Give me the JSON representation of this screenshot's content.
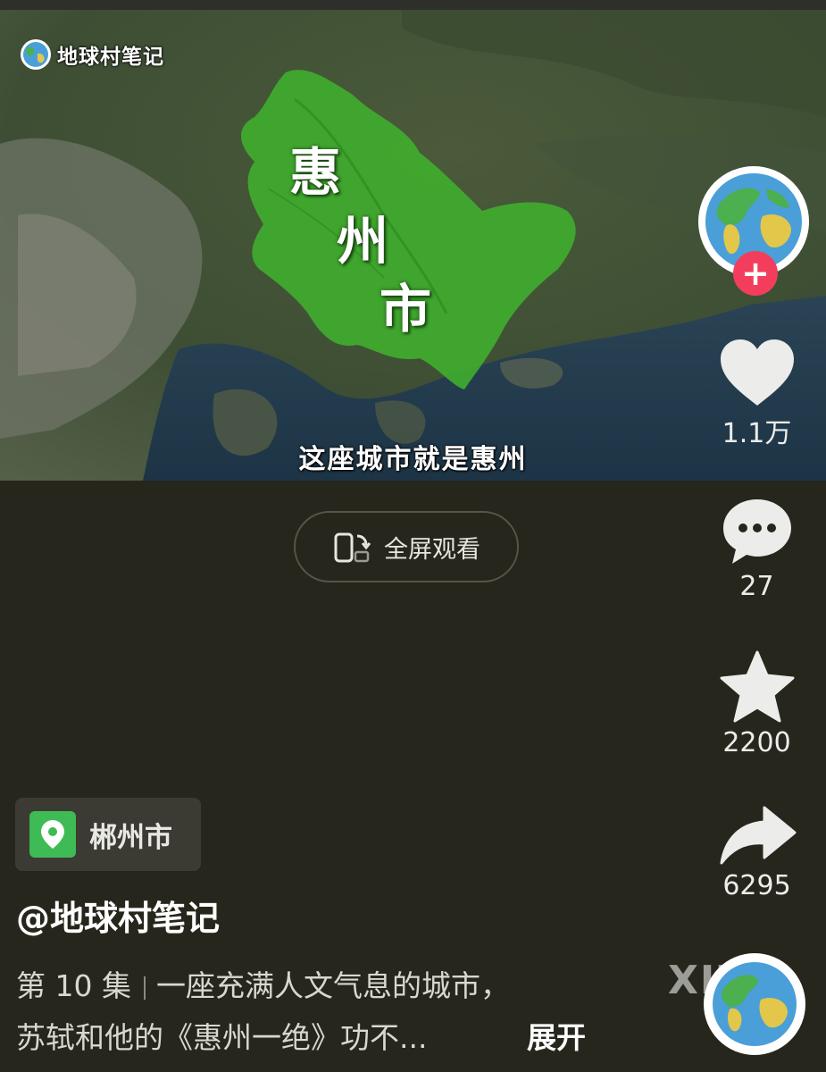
{
  "video": {
    "channel_logo_text": "地球村笔记",
    "map_labels": [
      "惠",
      "州",
      "市"
    ],
    "subtitle": "这座城市就是惠州"
  },
  "fullscreen_button": {
    "label": "全屏观看",
    "icon": "rotate-phone-icon"
  },
  "actions": {
    "like": {
      "icon": "heart-icon",
      "count": "1.1万"
    },
    "comment": {
      "icon": "comment-bubble-icon",
      "count": "27"
    },
    "collect": {
      "icon": "star-icon",
      "count": "2200"
    },
    "share": {
      "icon": "share-arrow-icon",
      "count": "6295"
    }
  },
  "follow_button": {
    "symbol": "+"
  },
  "location": {
    "icon": "map-pin-icon",
    "label": "郴州市"
  },
  "author": "@地球村笔记",
  "description": {
    "episode": "第 10 集",
    "line1_text": "一座充满人文气息的城市，",
    "line2_text": "苏轼和他的《惠州一绝》功不...",
    "expand_label": "展开"
  },
  "watermark": "XIZI",
  "colors": {
    "background": "#26261c",
    "highlight_region": "#3fae2e",
    "follow_button": "#f23e5c",
    "location_pin": "#3fbb55"
  }
}
